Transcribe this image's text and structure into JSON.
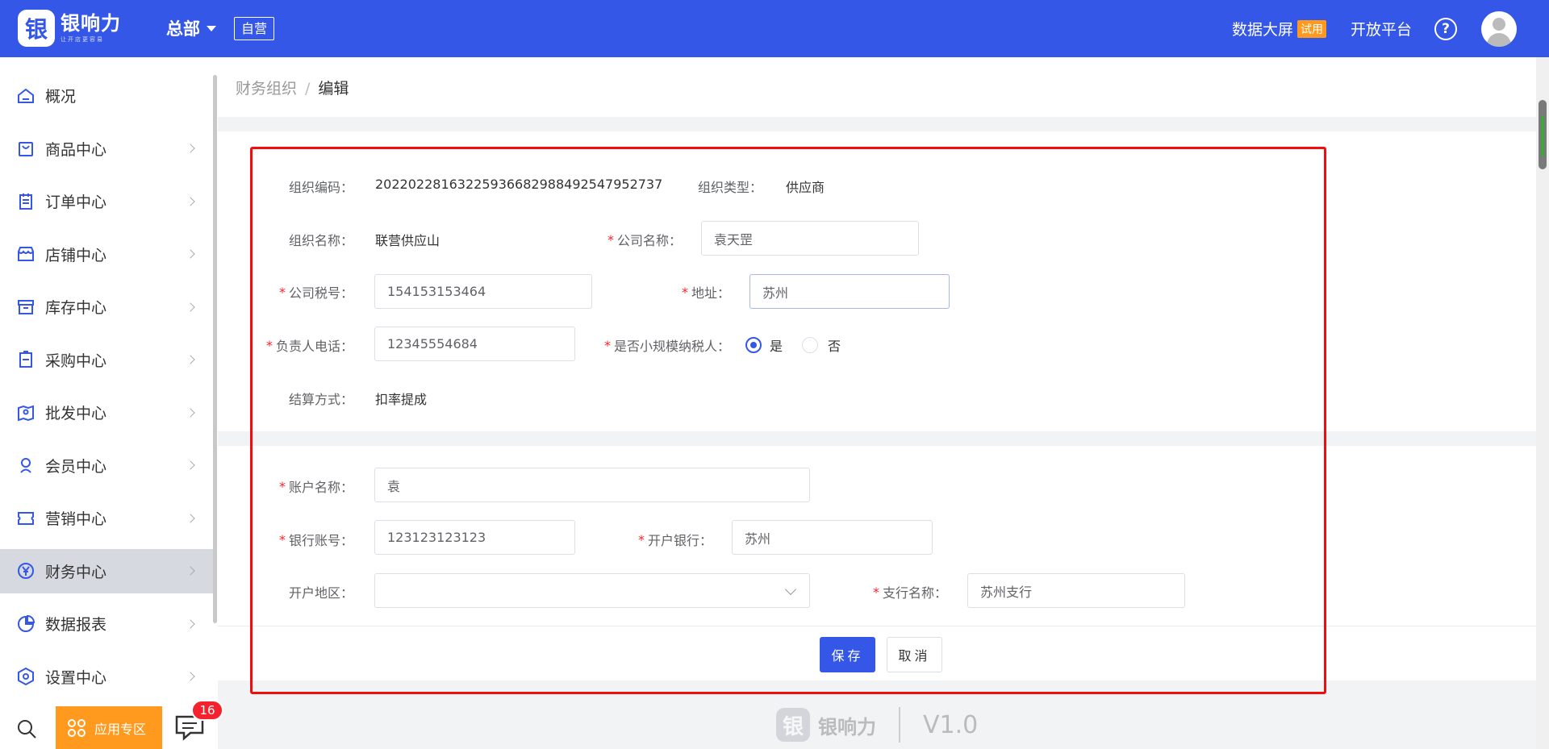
{
  "header": {
    "logo_glyph": "银",
    "logo_name": "银响力",
    "logo_slogan": "让开店更容易",
    "org_name": "总部",
    "self_tag": "自营",
    "dashboard": "数据大屏",
    "trial_badge": "试用",
    "open_platform": "开放平台",
    "help": "?"
  },
  "sidebar": {
    "items": [
      {
        "label": "概况",
        "icon": "home-icon"
      },
      {
        "label": "商品中心",
        "icon": "bag-icon"
      },
      {
        "label": "订单中心",
        "icon": "clipboard-icon"
      },
      {
        "label": "店铺中心",
        "icon": "store-icon"
      },
      {
        "label": "库存中心",
        "icon": "archive-icon"
      },
      {
        "label": "采购中心",
        "icon": "purchase-icon"
      },
      {
        "label": "批发中心",
        "icon": "map-pin-icon"
      },
      {
        "label": "会员中心",
        "icon": "member-icon"
      },
      {
        "label": "营销中心",
        "icon": "ticket-icon"
      },
      {
        "label": "财务中心",
        "icon": "yuan-icon",
        "active": true
      },
      {
        "label": "数据报表",
        "icon": "pie-icon"
      },
      {
        "label": "设置中心",
        "icon": "settings-icon"
      }
    ],
    "apps_label": "应用专区",
    "message_count": "16"
  },
  "breadcrumb": {
    "parent": "财务组织",
    "separator": "/",
    "current": "编辑"
  },
  "form": {
    "org_code_label": "组织编码：",
    "org_code": "20220228163225936682988492547952737",
    "org_type_label": "组织类型：",
    "org_type": "供应商",
    "org_name_label": "组织名称：",
    "org_name": "联营供应山",
    "company_name_label": "公司名称：",
    "company_name": "袁天罡",
    "tax_no_label": "公司税号：",
    "tax_no": "154153153464",
    "address_label": "地址：",
    "address": "苏州",
    "phone_label": "负责人电话：",
    "phone": "12345554684",
    "small_taxpayer_label": "是否小规模纳税人：",
    "yes_label": "是",
    "no_label": "否",
    "small_taxpayer_value": "是",
    "settlement_label": "结算方式：",
    "settlement": "扣率提成",
    "account_name_label": "账户名称：",
    "account_name": "袁",
    "bank_account_label": "银行账号：",
    "bank_account": "123123123123",
    "bank_label": "开户银行：",
    "bank": "苏州",
    "region_label": "开户地区：",
    "region": "",
    "branch_label": "支行名称：",
    "branch": "苏州支行",
    "required_mark": "*",
    "save": "保存",
    "cancel": "取消"
  },
  "footer": {
    "glyph": "银",
    "name": "银响力",
    "version": "V1.0"
  },
  "colors": {
    "brand": "#3557e8",
    "accent": "#ff9a1e",
    "highlight_frame": "#f10d0d"
  }
}
